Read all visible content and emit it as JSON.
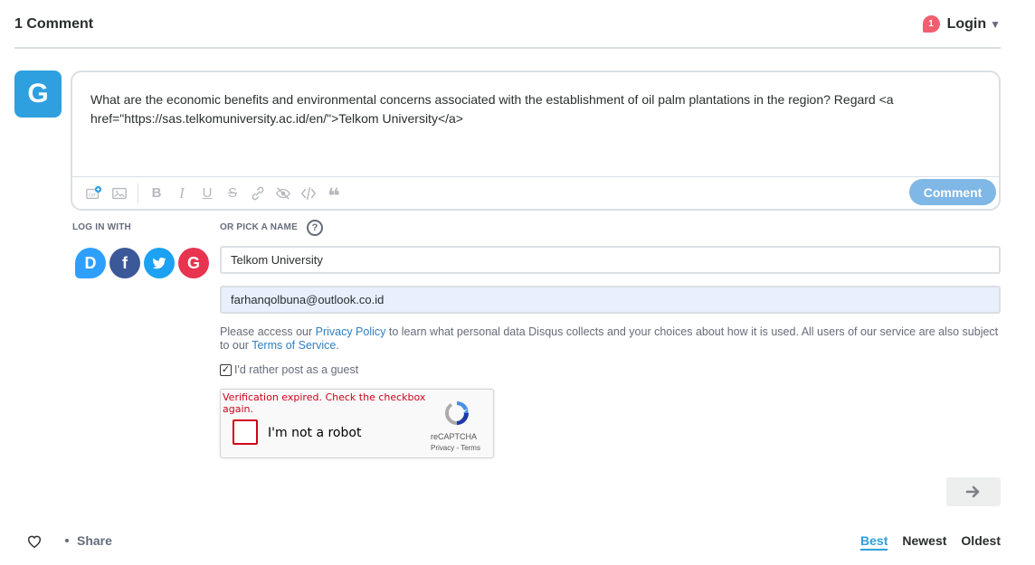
{
  "header": {
    "comment_count": "1 Comment",
    "notification_count": "1",
    "login_label": "Login"
  },
  "user": {
    "avatar_letter": "G",
    "avatar_color": "#2e9fdf"
  },
  "editor": {
    "text": "What are the economic benefits and environmental concerns associated with the establishment of oil palm plantations in the region? Regard <a href=\"https://sas.telkomuniversity.ac.id/en/\">Telkom University</a>",
    "comment_button": "Comment",
    "toolbar_icons": [
      "gif-icon",
      "image-icon",
      "bold-icon",
      "italic-icon",
      "underline-icon",
      "strikethrough-icon",
      "link-icon",
      "spoiler-icon",
      "code-icon",
      "quote-icon"
    ]
  },
  "login": {
    "log_in_with_label": "LOG IN WITH",
    "pick_name_label": "OR PICK A NAME",
    "help_glyph": "?",
    "providers": [
      {
        "name": "disqus",
        "glyph": "D",
        "color": "#2e9fff"
      },
      {
        "name": "facebook",
        "glyph": "f",
        "color": "#3b5998"
      },
      {
        "name": "twitter",
        "glyph": "t",
        "color": "#1da1f2"
      },
      {
        "name": "google",
        "glyph": "G",
        "color": "#dd4b39"
      }
    ]
  },
  "form": {
    "name_value": "Telkom University",
    "email_value": "farhanqolbuna@outlook.co.id",
    "policy_prefix": "Please access our ",
    "policy_link": "Privacy Policy",
    "policy_middle": " to learn what personal data Disqus collects and your choices about how it is used. All users of our service are also subject to our ",
    "terms_link": "Terms of Service",
    "policy_suffix": ".",
    "guest_checkbox_label": "I'd rather post as a guest",
    "guest_checked": true
  },
  "recaptcha": {
    "error": "Verification expired. Check the checkbox again.",
    "label": "I'm not a robot",
    "brand": "reCAPTCHA",
    "links": "Privacy - Terms"
  },
  "footer": {
    "share_label": "Share",
    "sort_options": [
      "Best",
      "Newest",
      "Oldest"
    ],
    "active_sort": "Best"
  }
}
